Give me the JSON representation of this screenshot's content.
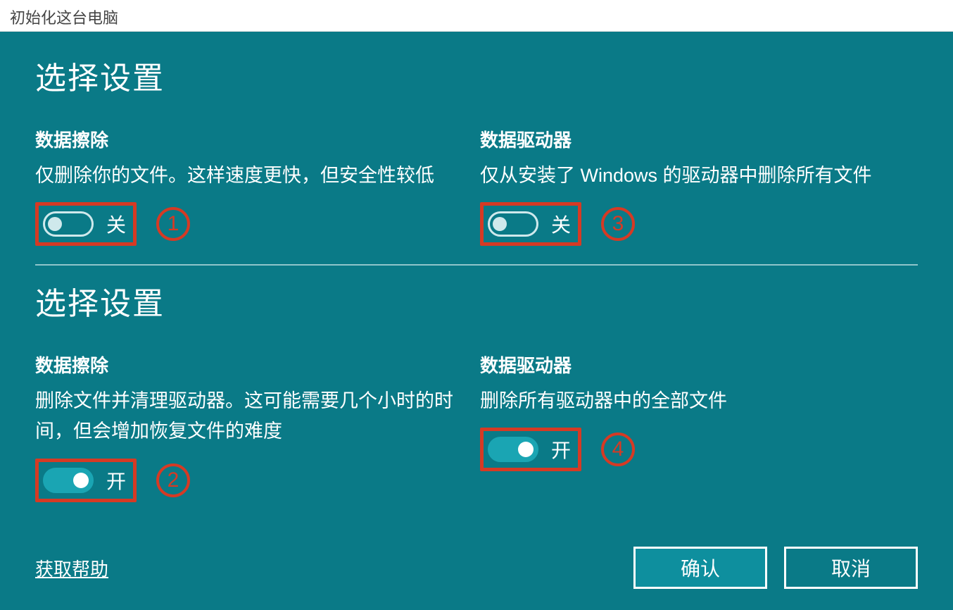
{
  "window": {
    "title": "初始化这台电脑"
  },
  "sections": [
    {
      "header": "选择设置",
      "left": {
        "title": "数据擦除",
        "desc": "仅删除你的文件。这样速度更快，但安全性较低",
        "state_label": "关",
        "state": "off",
        "annotation": "1"
      },
      "right": {
        "title": "数据驱动器",
        "desc": "仅从安装了 Windows 的驱动器中删除所有文件",
        "state_label": "关",
        "state": "off",
        "annotation": "3"
      }
    },
    {
      "header": "选择设置",
      "left": {
        "title": "数据擦除",
        "desc": "删除文件并清理驱动器。这可能需要几个小时的时间，但会增加恢复文件的难度",
        "state_label": "开",
        "state": "on",
        "annotation": "2"
      },
      "right": {
        "title": "数据驱动器",
        "desc": "删除所有驱动器中的全部文件",
        "state_label": "开",
        "state": "on",
        "annotation": "4"
      }
    }
  ],
  "footer": {
    "help": "获取帮助",
    "confirm": "确认",
    "cancel": "取消"
  },
  "colors": {
    "surface": "#0a7a87",
    "accent": "#1aa5b3",
    "highlight": "#d63a24"
  }
}
